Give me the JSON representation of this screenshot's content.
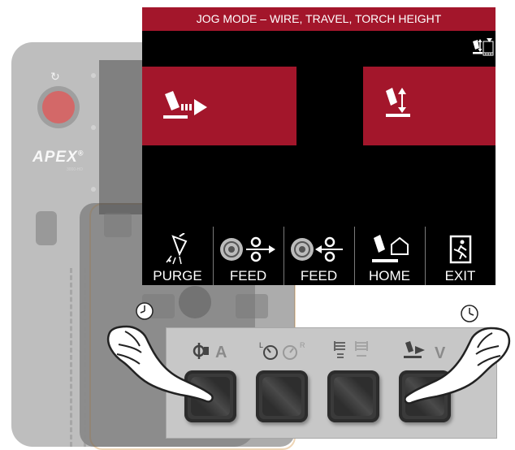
{
  "screen": {
    "title": "JOG MODE – WIRE, TRAVEL, TORCH HEIGHT",
    "status_icon": "torch-height-scale-icon",
    "jog_buttons": [
      {
        "name": "jog-wire-button",
        "icon": "wire-jog-arrow-icon"
      },
      {
        "name": "jog-torch-height-button",
        "icon": "torch-height-updown-icon"
      }
    ],
    "softkeys": [
      {
        "label": "PURGE",
        "icon": "gas-purge-icon"
      },
      {
        "label": "FEED",
        "icon": "wire-feed-forward-icon"
      },
      {
        "label": "FEED",
        "icon": "wire-feed-reverse-icon"
      },
      {
        "label": "HOME",
        "icon": "home-torch-icon"
      },
      {
        "label": "EXIT",
        "icon": "exit-door-icon"
      }
    ]
  },
  "pendant": {
    "brand": "APEX",
    "brand_mark": "®",
    "model": "3000-HD"
  },
  "panel": {
    "legend_amps": "A",
    "legend_volts": "V",
    "legend_left_mark": "L",
    "legend_right_mark": "R"
  },
  "colors": {
    "accent": "#a3162b",
    "screen_bg": "#000000",
    "panel_bg": "#c7c7c7"
  }
}
